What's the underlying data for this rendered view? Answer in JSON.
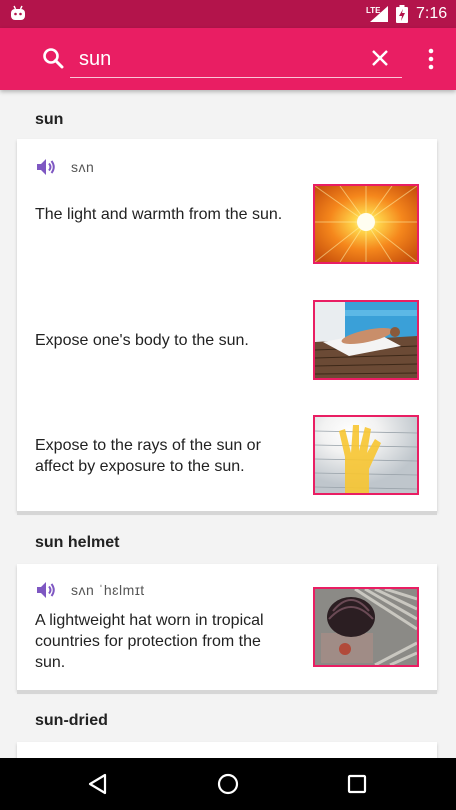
{
  "status_bar": {
    "network_label": "LTE",
    "time": "7:16"
  },
  "search": {
    "query": "sun"
  },
  "entries": [
    {
      "headword": "sun",
      "pronunciation": "sʌn",
      "definitions": [
        {
          "text": "The light and warmth from the sun.",
          "image": "sunburst-photo"
        },
        {
          "text": "Expose one's body to the sun.",
          "image": "sunbather-photo"
        },
        {
          "text": "Expose to the rays of the sun or affect by exposure to the sun.",
          "image": "hand-sunlight-photo"
        }
      ]
    },
    {
      "headword": "sun helmet",
      "pronunciation": "sʌn ˈhɛlmɪt",
      "definitions": [
        {
          "text": "A lightweight hat worn in tropical countries for protection from the sun.",
          "image": "helmet-photo"
        }
      ]
    },
    {
      "headword": "sun-dried",
      "definitions": []
    }
  ],
  "colors": {
    "primary": "#e91e63",
    "primary_dark": "#b3144b",
    "speaker": "#7e57c2"
  }
}
